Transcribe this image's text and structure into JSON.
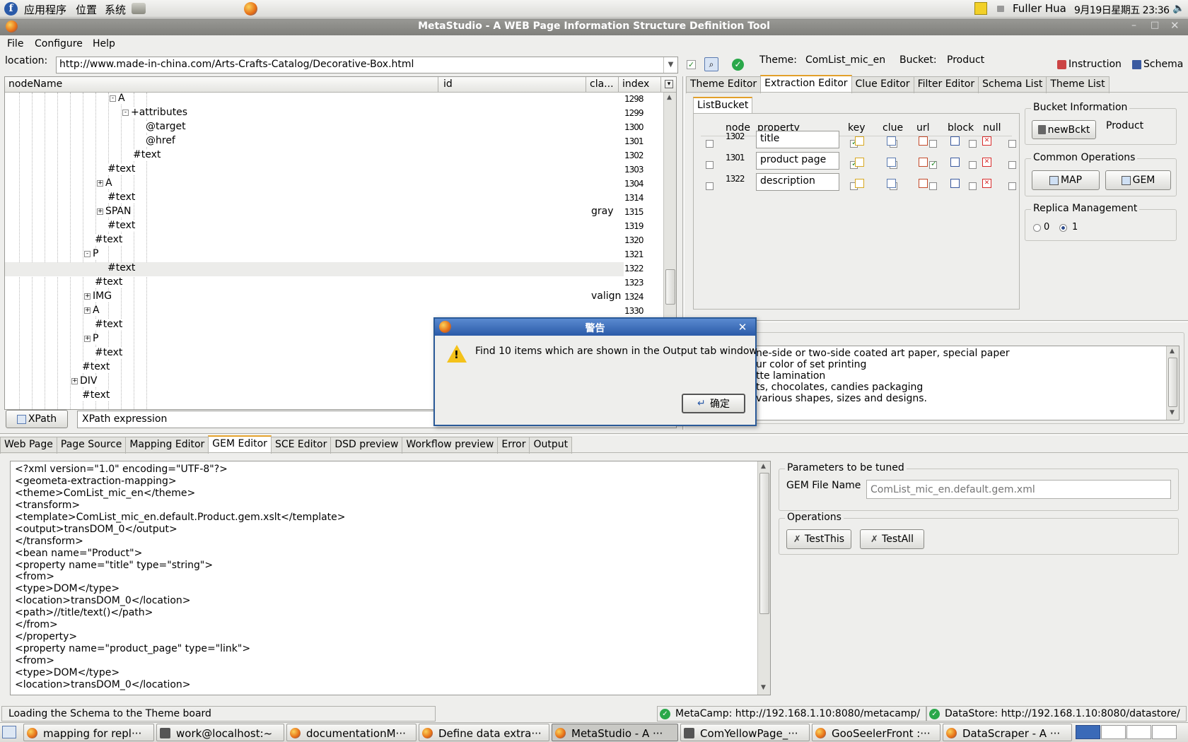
{
  "panel": {
    "apps": "应用程序",
    "places": "位置",
    "system": "系统",
    "user": "Fuller Hua",
    "clock": "9月19日星期五 23:36"
  },
  "window": {
    "title": "MetaStudio - A WEB Page Information Structure Definition Tool"
  },
  "menu": {
    "file": "File",
    "configure": "Configure",
    "help": "Help"
  },
  "toolbar": {
    "location_label": "location:",
    "location_value": "http://www.made-in-china.com/Arts-Crafts-Catalog/Decorative-Box.html",
    "theme_label": "Theme:",
    "theme_value": "ComList_mic_en",
    "bucket_label": "Bucket:",
    "bucket_value": "Product",
    "instruction": "Instruction",
    "schema": "Schema"
  },
  "tree": {
    "headers": {
      "nodename": "nodeName",
      "id": "id",
      "cla": "cla...",
      "index": "index"
    },
    "rows": [
      {
        "name": "A",
        "cls": "",
        "index": "1298"
      },
      {
        "name": "+attributes",
        "cls": "",
        "index": "1299"
      },
      {
        "name": "@target",
        "cls": "",
        "index": "1300"
      },
      {
        "name": "@href",
        "cls": "",
        "index": "1301"
      },
      {
        "name": "#text",
        "cls": "",
        "index": "1302"
      },
      {
        "name": "#text",
        "cls": "",
        "index": "1303"
      },
      {
        "name": "A",
        "cls": "",
        "index": "1304"
      },
      {
        "name": "#text",
        "cls": "",
        "index": "1314"
      },
      {
        "name": "SPAN",
        "cls": "gray",
        "index": "1315"
      },
      {
        "name": "#text",
        "cls": "",
        "index": "1319"
      },
      {
        "name": "#text",
        "cls": "",
        "index": "1320"
      },
      {
        "name": "P",
        "cls": "",
        "index": "1321"
      },
      {
        "name": "#text",
        "cls": "",
        "index": "1322"
      },
      {
        "name": "#text",
        "cls": "",
        "index": "1323"
      },
      {
        "name": "IMG",
        "cls": "valign",
        "index": "1324"
      },
      {
        "name": "A",
        "cls": "",
        "index": "1330"
      },
      {
        "name": "#text",
        "cls": "",
        "index": ""
      },
      {
        "name": "P",
        "cls": "",
        "index": ""
      },
      {
        "name": "#text",
        "cls": "",
        "index": ""
      },
      {
        "name": "#text",
        "cls": "",
        "index": ""
      },
      {
        "name": "DIV",
        "cls": "",
        "index": ""
      },
      {
        "name": "#text",
        "cls": "",
        "index": ""
      }
    ],
    "xpath_button": "XPath",
    "xpath_value": "XPath expression"
  },
  "right_tabs": [
    "Theme Editor",
    "Extraction Editor",
    "Clue Editor",
    "Filter Editor",
    "Schema List",
    "Theme List"
  ],
  "listbucket": {
    "tab": "ListBucket",
    "headers": {
      "node": "node",
      "property": "property",
      "key": "key",
      "clue": "clue",
      "url": "url",
      "block": "block",
      "null": "null"
    },
    "rows": [
      {
        "node": "1302",
        "property": "title",
        "key": true,
        "clue": false,
        "url": false,
        "block": false,
        "nul": false
      },
      {
        "node": "1301",
        "property": "product page",
        "key": true,
        "clue": true,
        "url": true,
        "block": false,
        "nul": false
      },
      {
        "node": "1322",
        "property": "description",
        "key": false,
        "clue": false,
        "url": false,
        "block": false,
        "nul": false
      }
    ]
  },
  "bucket_info": {
    "title": "Bucket Information",
    "new_button": "newBckt",
    "name": "Product"
  },
  "common_ops": {
    "title": "Common Operations",
    "map": "MAP",
    "gem": "GEM"
  },
  "replica": {
    "title": "Replica Management",
    "opt0": "0",
    "opt1": "1",
    "selected": "1"
  },
  "preview_lines": [
    "ne-side or two-side coated art paper, special paper",
    "ur color of set printing",
    "tte lamination",
    "ts, chocolates, candies packaging",
    "various shapes, sizes and designs."
  ],
  "dialog": {
    "title": "警告",
    "message": "Find 10 items which are shown in the Output tab window",
    "ok": "确定"
  },
  "bottom_tabs": [
    "Web Page",
    "Page Source",
    "Mapping Editor",
    "GEM Editor",
    "SCE Editor",
    "DSD preview",
    "Workflow preview",
    "Error",
    "Output"
  ],
  "code_lines": [
    "<?xml version=\"1.0\" encoding=\"UTF-8\"?>",
    "<geometa-extraction-mapping>",
    "<theme>ComList_mic_en</theme>",
    "<transform>",
    "<template>ComList_mic_en.default.Product.gem.xslt</template>",
    "<output>transDOM_0</output>",
    "</transform>",
    "<bean name=\"Product\">",
    "<property name=\"title\" type=\"string\">",
    "<from>",
    "<type>DOM</type>",
    "<location>transDOM_0</location>",
    "<path>//title/text()</path>",
    "</from>",
    "</property>",
    "<property name=\"product_page\" type=\"link\">",
    "<from>",
    "<type>DOM</type>",
    "<location>transDOM_0</location>"
  ],
  "params": {
    "title": "Parameters to be tuned",
    "gem_label": "GEM File Name",
    "gem_placeholder": "ComList_mic_en.default.gem.xml"
  },
  "operations": {
    "title": "Operations",
    "test_this": "TestThis",
    "test_all": "TestAll"
  },
  "status": {
    "left": "Loading the Schema to the Theme board",
    "metacamp": "MetaCamp: http://192.168.1.10:8080/metacamp/",
    "datastore": "DataStore: http://192.168.1.10:8080/datastore/"
  },
  "taskbar": [
    "mapping for repl···",
    "work@localhost:~",
    "documentationM···",
    "Define data extra···",
    "MetaStudio - A ···",
    "ComYellowPage_···",
    "GooSeelerFront :···",
    "DataScraper - A ···"
  ]
}
